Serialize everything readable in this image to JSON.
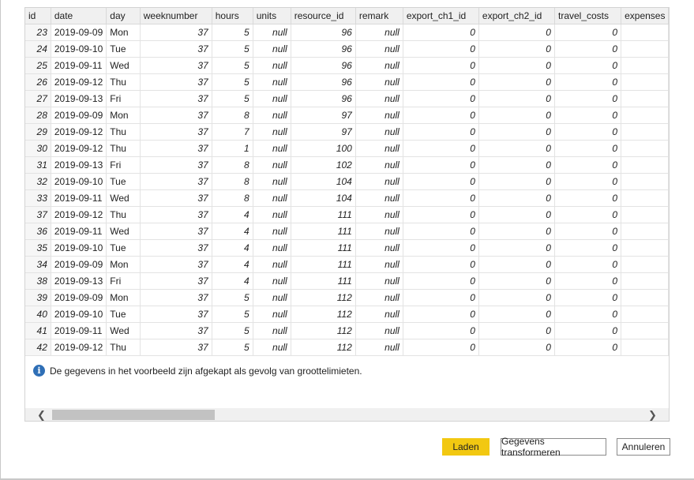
{
  "columns": [
    "id",
    "date",
    "day",
    "weeknumber",
    "hours",
    "units",
    "resource_id",
    "remark",
    "export_ch1_id",
    "export_ch2_id",
    "travel_costs",
    "expenses"
  ],
  "rows": [
    [
      "23",
      "2019-09-09",
      "Mon",
      "37",
      "5",
      "null",
      "96",
      "null",
      "0",
      "0",
      "0",
      ""
    ],
    [
      "24",
      "2019-09-10",
      "Tue",
      "37",
      "5",
      "null",
      "96",
      "null",
      "0",
      "0",
      "0",
      ""
    ],
    [
      "25",
      "2019-09-11",
      "Wed",
      "37",
      "5",
      "null",
      "96",
      "null",
      "0",
      "0",
      "0",
      ""
    ],
    [
      "26",
      "2019-09-12",
      "Thu",
      "37",
      "5",
      "null",
      "96",
      "null",
      "0",
      "0",
      "0",
      ""
    ],
    [
      "27",
      "2019-09-13",
      "Fri",
      "37",
      "5",
      "null",
      "96",
      "null",
      "0",
      "0",
      "0",
      ""
    ],
    [
      "28",
      "2019-09-09",
      "Mon",
      "37",
      "8",
      "null",
      "97",
      "null",
      "0",
      "0",
      "0",
      ""
    ],
    [
      "29",
      "2019-09-12",
      "Thu",
      "37",
      "7",
      "null",
      "97",
      "null",
      "0",
      "0",
      "0",
      ""
    ],
    [
      "30",
      "2019-09-12",
      "Thu",
      "37",
      "1",
      "null",
      "100",
      "null",
      "0",
      "0",
      "0",
      ""
    ],
    [
      "31",
      "2019-09-13",
      "Fri",
      "37",
      "8",
      "null",
      "102",
      "null",
      "0",
      "0",
      "0",
      ""
    ],
    [
      "32",
      "2019-09-10",
      "Tue",
      "37",
      "8",
      "null",
      "104",
      "null",
      "0",
      "0",
      "0",
      ""
    ],
    [
      "33",
      "2019-09-11",
      "Wed",
      "37",
      "8",
      "null",
      "104",
      "null",
      "0",
      "0",
      "0",
      ""
    ],
    [
      "37",
      "2019-09-12",
      "Thu",
      "37",
      "4",
      "null",
      "111",
      "null",
      "0",
      "0",
      "0",
      ""
    ],
    [
      "36",
      "2019-09-11",
      "Wed",
      "37",
      "4",
      "null",
      "111",
      "null",
      "0",
      "0",
      "0",
      ""
    ],
    [
      "35",
      "2019-09-10",
      "Tue",
      "37",
      "4",
      "null",
      "111",
      "null",
      "0",
      "0",
      "0",
      ""
    ],
    [
      "34",
      "2019-09-09",
      "Mon",
      "37",
      "4",
      "null",
      "111",
      "null",
      "0",
      "0",
      "0",
      ""
    ],
    [
      "38",
      "2019-09-13",
      "Fri",
      "37",
      "4",
      "null",
      "111",
      "null",
      "0",
      "0",
      "0",
      ""
    ],
    [
      "39",
      "2019-09-09",
      "Mon",
      "37",
      "5",
      "null",
      "112",
      "null",
      "0",
      "0",
      "0",
      ""
    ],
    [
      "40",
      "2019-09-10",
      "Tue",
      "37",
      "5",
      "null",
      "112",
      "null",
      "0",
      "0",
      "0",
      ""
    ],
    [
      "41",
      "2019-09-11",
      "Wed",
      "37",
      "5",
      "null",
      "112",
      "null",
      "0",
      "0",
      "0",
      ""
    ],
    [
      "42",
      "2019-09-12",
      "Thu",
      "37",
      "5",
      "null",
      "112",
      "null",
      "0",
      "0",
      "0",
      ""
    ]
  ],
  "notice": {
    "icon": "info-icon",
    "text": "De gegevens in het voorbeeld zijn afgekapt als gevolg van groottelimieten."
  },
  "scrollbar": {
    "left_arrow": "❮",
    "right_arrow": "❯",
    "position": 0
  },
  "buttons": {
    "load": "Laden",
    "transform": "Gegevens transformeren",
    "cancel": "Annuleren"
  },
  "colors": {
    "primary_button": "#f2c811",
    "info_icon": "#2f6fb6"
  }
}
